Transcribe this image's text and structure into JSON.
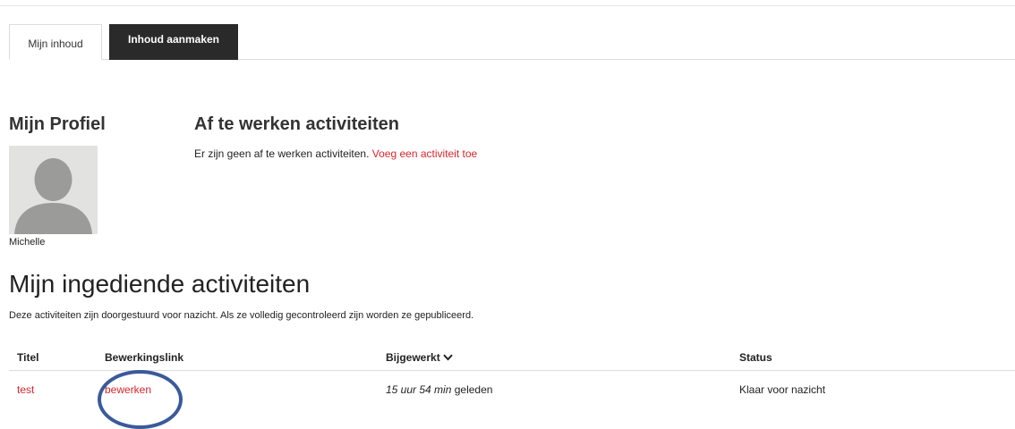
{
  "tabs": [
    {
      "label": "Mijn inhoud",
      "active": true
    },
    {
      "label": "Inhoud aanmaken",
      "active": false
    }
  ],
  "profile": {
    "title": "Mijn Profiel",
    "name": "Michelle"
  },
  "todo": {
    "title": "Af te werken activiteiten",
    "text": "Er zijn geen af te werken activiteiten.",
    "link_label": "Voeg een activiteit toe"
  },
  "submitted": {
    "title": "Mijn ingediende activiteiten",
    "description": "Deze activiteiten zijn doorgestuurd voor nazicht. Als ze volledig gecontroleerd zijn worden ze gepubliceerd.",
    "columns": [
      "Titel",
      "Bewerkingslink",
      "Bijgewerkt",
      "Status"
    ],
    "rows": [
      {
        "title": "test",
        "edit_link": "bewerken",
        "updated_prefix": "15 uur 54 min",
        "updated_suffix": "geleden",
        "status": "Klaar voor nazicht"
      }
    ]
  },
  "colors": {
    "link": "#d9262e",
    "tab_dark": "#2a2a2a",
    "annotation": "#3a5a9a"
  },
  "icons": {
    "sort": "chevron-down-icon",
    "avatar": "user-silhouette-icon"
  }
}
